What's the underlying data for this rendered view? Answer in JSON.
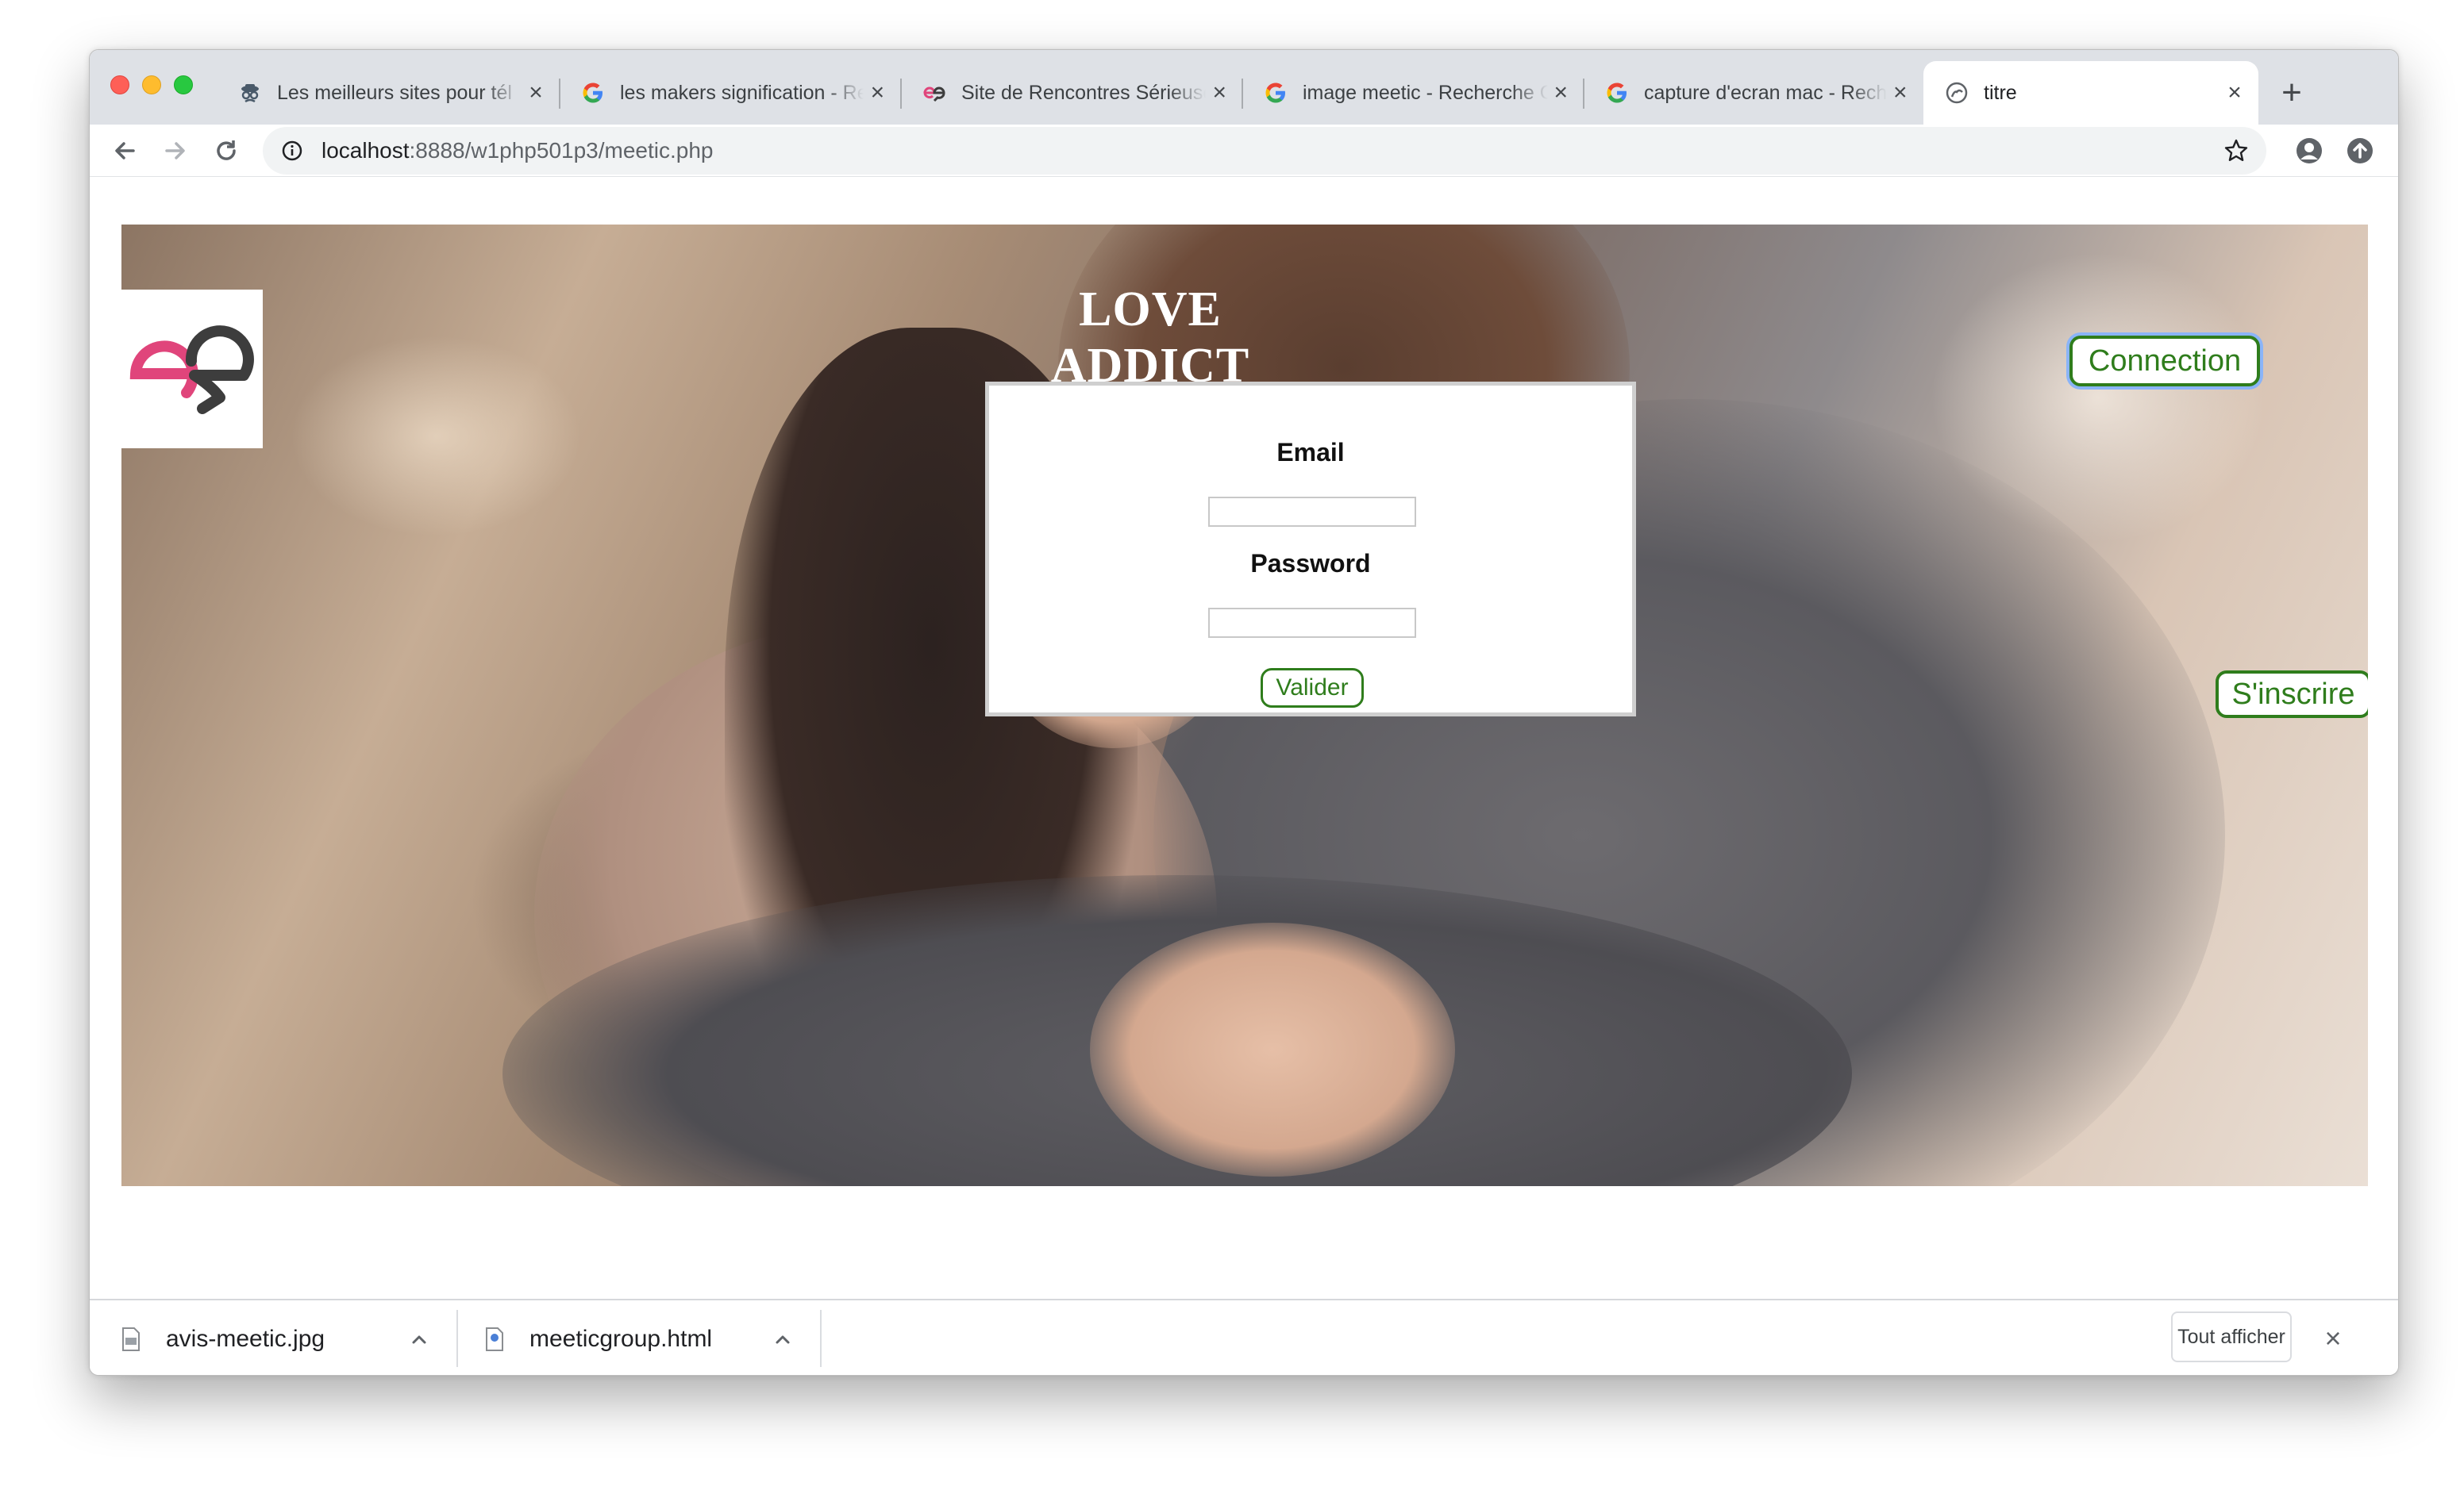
{
  "browser": {
    "tabs": [
      {
        "title": "Les meilleurs sites pour tél",
        "icon": "spy-icon",
        "active": false
      },
      {
        "title": "les makers signification - Re",
        "icon": "google-icon",
        "active": false
      },
      {
        "title": "Site de Rencontres Sérieuses",
        "icon": "meetic-heart-icon",
        "active": false
      },
      {
        "title": "image meetic - Recherche Go",
        "icon": "google-icon",
        "active": false
      },
      {
        "title": "capture d'ecran mac - Reche",
        "icon": "google-icon",
        "active": false
      },
      {
        "title": "titre",
        "icon": "globe-icon",
        "active": true
      }
    ],
    "url": {
      "host": "localhost",
      "path": ":8888/w1php501p3/meetic.php"
    }
  },
  "page": {
    "title": "LOVE ADDICT",
    "login": {
      "email_label": "Email",
      "email_value": "",
      "password_label": "Password",
      "password_value": "",
      "submit_label": "Valider"
    },
    "connection_button": "Connection",
    "signup_button": "S'inscrire"
  },
  "downloads": {
    "items": [
      {
        "filename": "avis-meetic.jpg"
      },
      {
        "filename": "meeticgroup.html"
      }
    ],
    "show_all_label": "Tout afficher"
  },
  "colors": {
    "accent_green": "#2f7d1c",
    "logo_pink": "#e0457b",
    "logo_dark": "#3d3d3d",
    "focus_ring": "#8ab4f8"
  }
}
